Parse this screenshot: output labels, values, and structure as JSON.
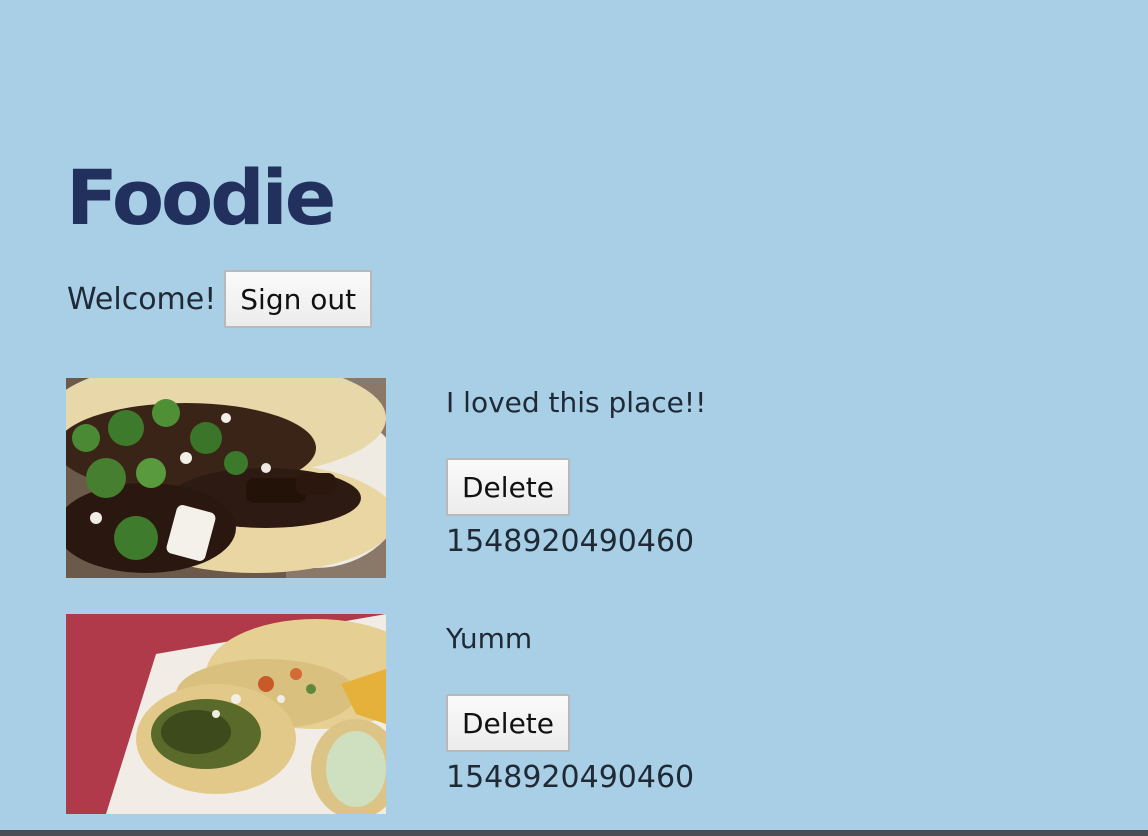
{
  "app": {
    "title": "Foodie"
  },
  "header": {
    "welcome_text": "Welcome!",
    "sign_out_label": "Sign out"
  },
  "posts": [
    {
      "text": "I loved this place!!",
      "delete_label": "Delete",
      "timestamp": "1548920490460",
      "image_alt": "tacos-photo"
    },
    {
      "text": "Yumm",
      "delete_label": "Delete",
      "timestamp": "1548920490460",
      "image_alt": "tacos-photo"
    }
  ],
  "colors": {
    "background": "#a8cfe5",
    "title": "#22305e",
    "text": "#1f2a36"
  }
}
